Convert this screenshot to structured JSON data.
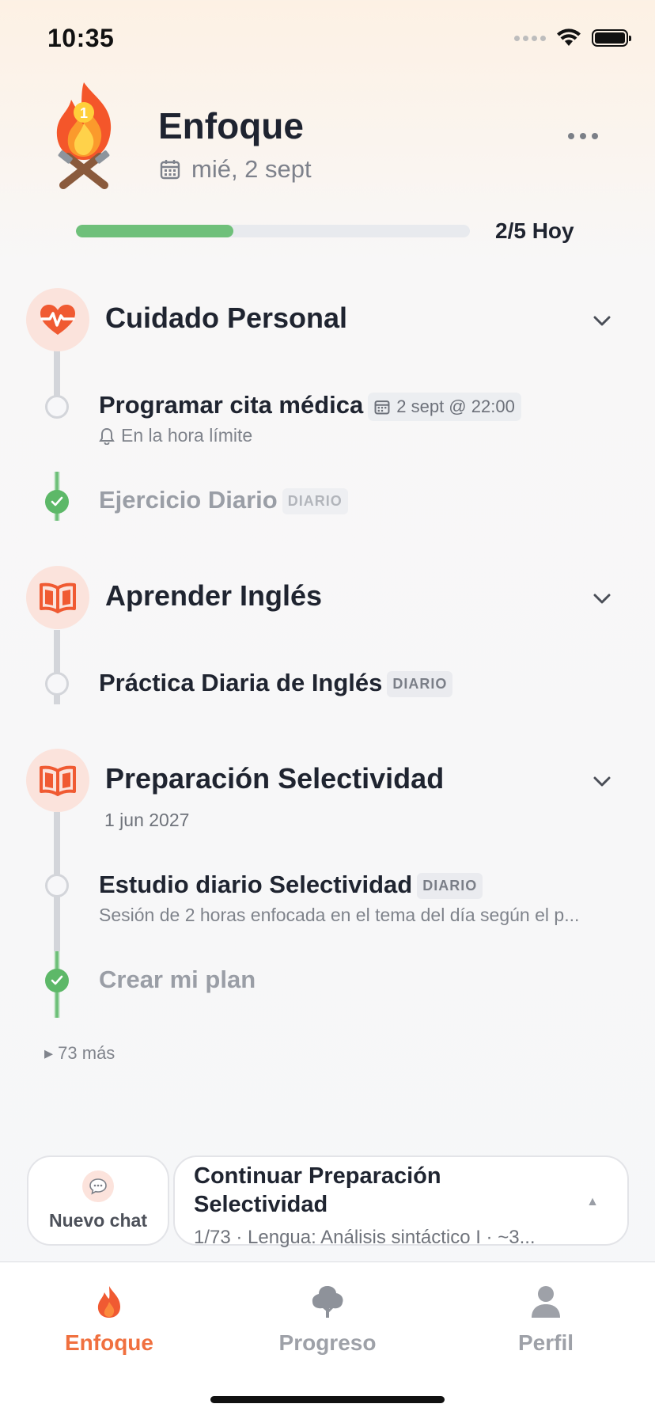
{
  "status_bar": {
    "time": "10:35"
  },
  "header": {
    "title": "Enfoque",
    "date": "mié, 2 sept",
    "progress_fraction": 0.4,
    "progress_label": "2/5 Hoy"
  },
  "categories": [
    {
      "title": "Cuidado Personal",
      "icon": "heart-pulse-icon",
      "tasks": [
        {
          "title": "Programar cita médica",
          "due": "2 sept @ 22:00",
          "reminder": "En la hora límite",
          "done": false
        },
        {
          "title": "Ejercicio Diario",
          "tag": "DIARIO",
          "done": true
        }
      ]
    },
    {
      "title": "Aprender Inglés",
      "icon": "open-book-icon",
      "tasks": [
        {
          "title": "Práctica Diaria de Inglés",
          "tag": "DIARIO",
          "done": false
        }
      ]
    },
    {
      "title": "Preparación Selectividad",
      "icon": "open-book-icon",
      "goal_date": "1 jun 2027",
      "tasks": [
        {
          "title": "Estudio diario Selectividad",
          "tag": "DIARIO",
          "description": "Sesión de 2 horas enfocada en el tema del día según el p...",
          "done": false
        },
        {
          "title": "Crear mi plan",
          "done": true
        }
      ]
    }
  ],
  "more_link": "▸ 73 más",
  "actions": {
    "new_chat_label": "Nuevo chat",
    "continue_title": "Continuar Preparación Selectividad",
    "continue_subtitle": "1/73 · Lengua: Análisis sintáctico I · ~3..."
  },
  "tabs": [
    {
      "label": "Enfoque",
      "icon": "flame-icon",
      "active": true
    },
    {
      "label": "Progreso",
      "icon": "tree-icon",
      "active": false
    },
    {
      "label": "Perfil",
      "icon": "person-icon",
      "active": false
    }
  ],
  "colors": {
    "accent": "#f0703f",
    "success": "#5db868",
    "badge_bg": "#fbe3dc"
  }
}
